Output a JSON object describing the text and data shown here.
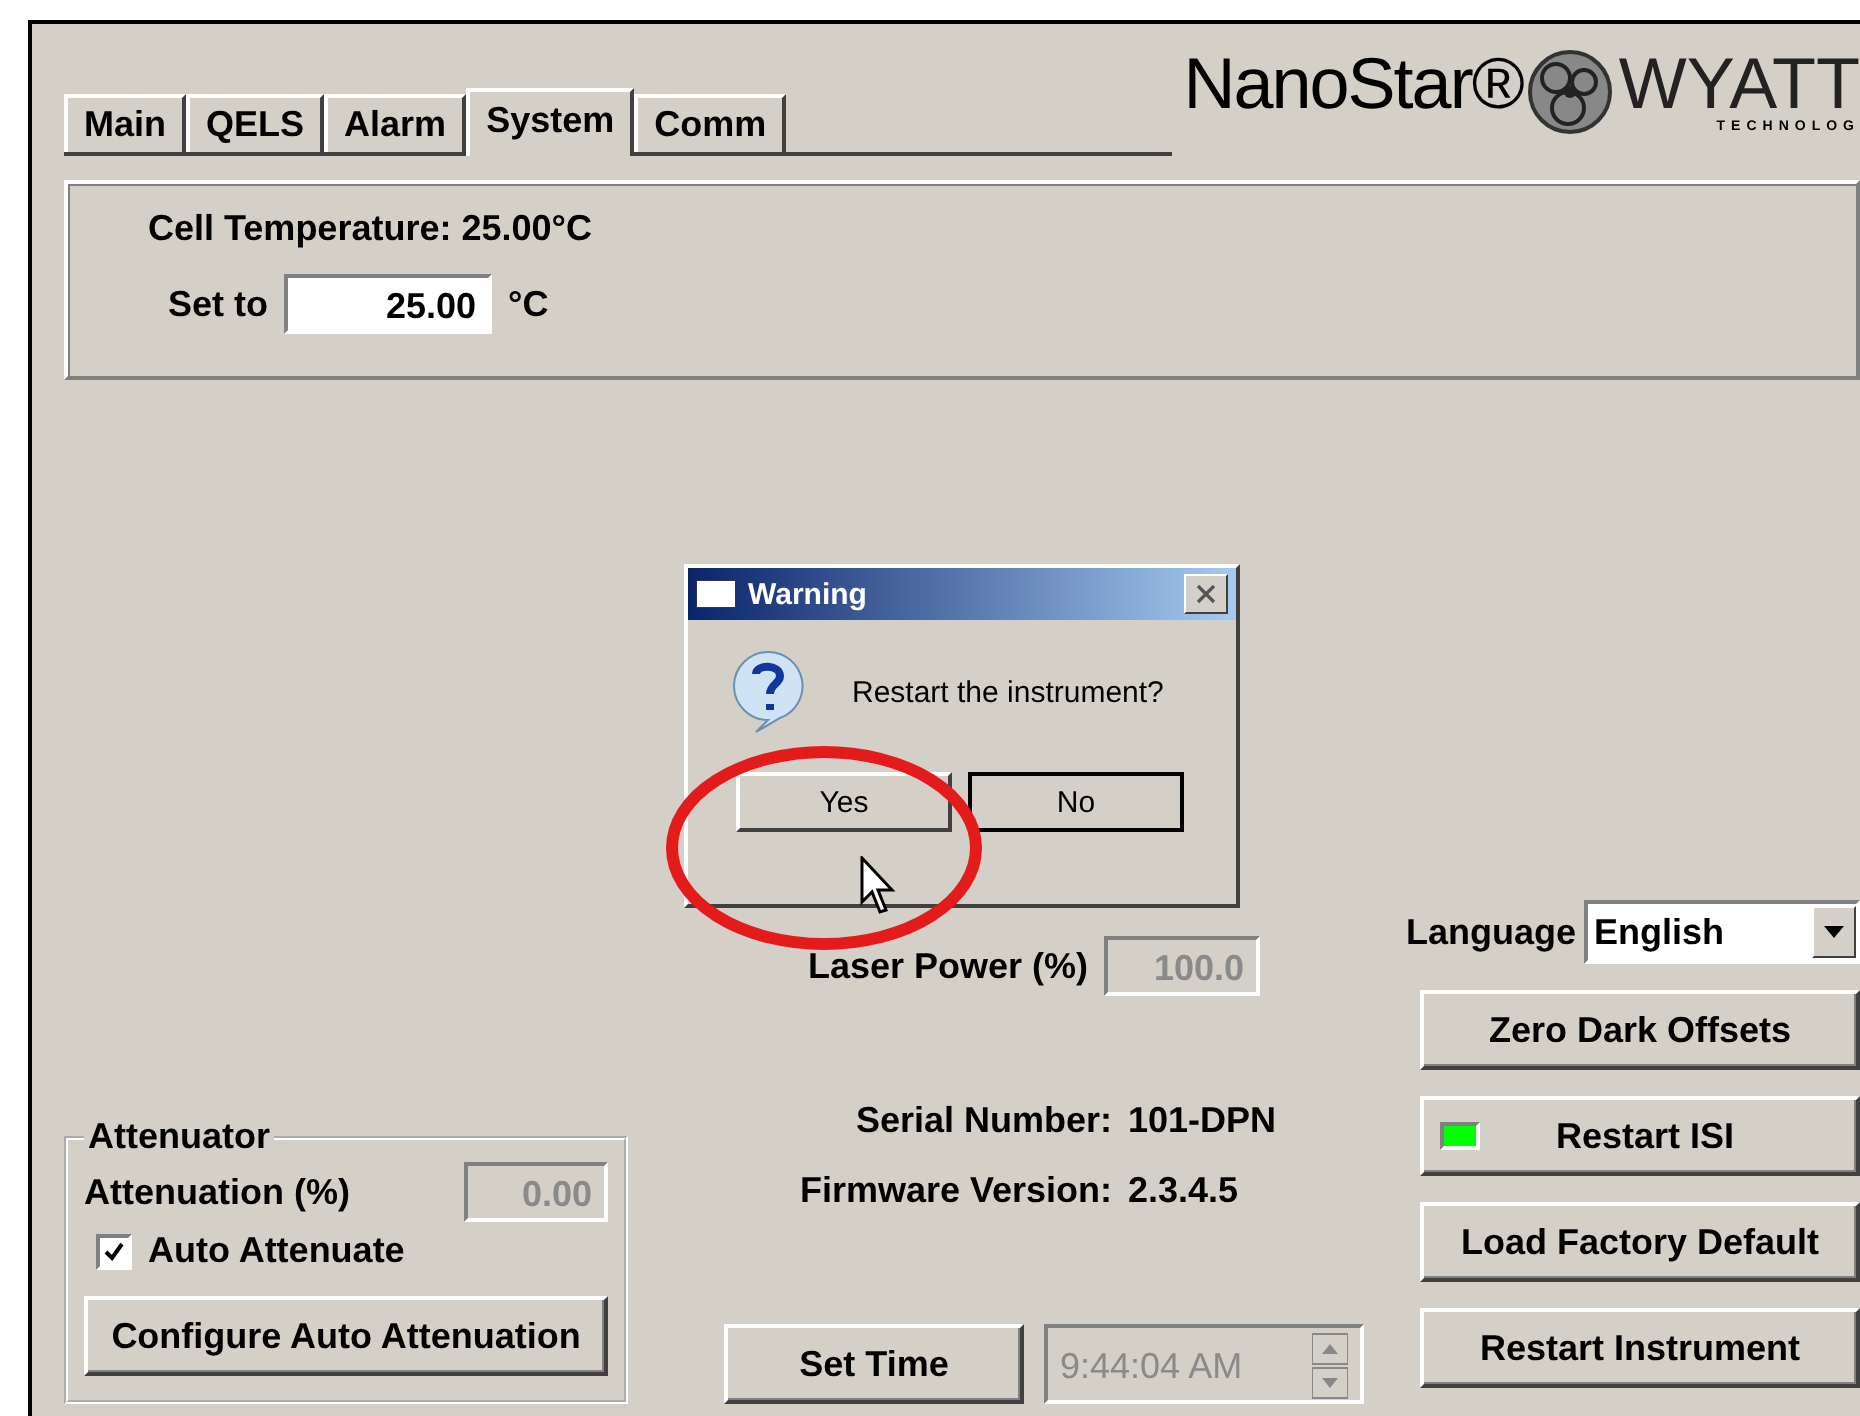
{
  "tabs": [
    {
      "label": "Main",
      "selected": false
    },
    {
      "label": "QELS",
      "selected": false
    },
    {
      "label": "Alarm",
      "selected": false
    },
    {
      "label": "System",
      "selected": true
    },
    {
      "label": "Comm",
      "selected": false
    }
  ],
  "logo": {
    "brand": "NanoStar®",
    "company": "WYATT",
    "tagline": "TECHNOLOG"
  },
  "temperature": {
    "reading": "Cell Temperature: 25.00°C",
    "set_label": "Set to",
    "value": "25.00",
    "unit": "°C"
  },
  "laser": {
    "label": "Laser Power (%)",
    "value": "100.0",
    "disabled": true
  },
  "attenuator": {
    "title": "Attenuator",
    "label": "Attenuation (%)",
    "value": "0.00",
    "disabled": true,
    "auto": {
      "label": "Auto Attenuate",
      "checked": true
    },
    "button": "Configure Auto Attenuation"
  },
  "info": [
    {
      "label": "Serial Number:",
      "value": "101-DPN"
    },
    {
      "label": "Firmware Version:",
      "value": "2.3.4.5"
    }
  ],
  "time": {
    "button": "Set Time",
    "value": "9:44:04 AM",
    "disabled": true
  },
  "language": {
    "label": "Language",
    "value": "English"
  },
  "actions": [
    {
      "label": "Zero Dark Offsets",
      "kind": "plain"
    },
    {
      "label": "Restart ISI",
      "kind": "led",
      "color": "#00ff00"
    },
    {
      "label": "Load Factory Default",
      "kind": "plain"
    },
    {
      "label": "Restart Instrument",
      "kind": "plain"
    }
  ],
  "dialog": {
    "title": "Warning",
    "message": "Restart the instrument?",
    "buttons": [
      {
        "label": "Yes",
        "default": false,
        "circled": true
      },
      {
        "label": "No",
        "default": true,
        "circled": false
      }
    ]
  }
}
